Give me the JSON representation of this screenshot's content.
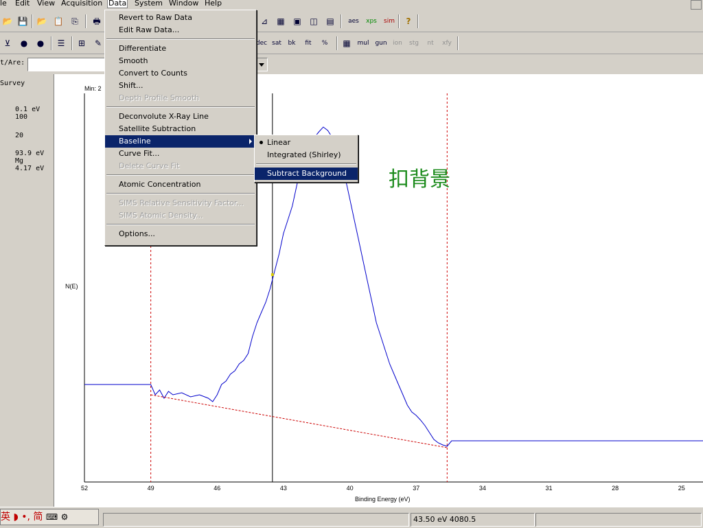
{
  "menubar": {
    "items": [
      "le",
      "Edit",
      "View",
      "Acquisition",
      "Data",
      "System",
      "Window",
      "Help"
    ]
  },
  "toolbar1": {
    "icons": [
      "open-icon",
      "save-icon",
      "open-folder-icon",
      "clipboard-icon",
      "copy-icon",
      "print-icon"
    ],
    "right_icons": [
      "line-plot-icon",
      "grid-plot-icon",
      "image-plot-icon",
      "peak-icon",
      "stack-icon"
    ],
    "aes_label": "aes",
    "xps_label": "xps",
    "sim_label": "sim",
    "help_label": "?"
  },
  "toolbar2": {
    "labels": [
      "dec",
      "sat",
      "bk",
      "fit",
      "%",
      "mul",
      "gun",
      "ion",
      "stg",
      "nt",
      "xfy"
    ]
  },
  "row3": {
    "label": "t/Are:",
    "input_value": ""
  },
  "left_panel": {
    "title": "Survey",
    "lines": [
      "0.1 eV",
      "100",
      "",
      "20",
      "",
      "93.9 eV",
      "Mg",
      "4.17 eV"
    ]
  },
  "plot": {
    "min_label": "Min: 2",
    "ylabel": "N(E)",
    "xlabel": "Binding Energy (eV)",
    "xticks": [
      "52",
      "49",
      "46",
      "43",
      "40",
      "37",
      "34",
      "31",
      "28",
      "25"
    ]
  },
  "annotation": "扣背景",
  "data_menu": {
    "items": [
      {
        "label": "Revert to Raw Data",
        "enabled": true
      },
      {
        "label": "Edit Raw Data...",
        "enabled": true
      },
      {
        "sep": true
      },
      {
        "label": "Differentiate",
        "enabled": true
      },
      {
        "label": "Smooth",
        "enabled": true
      },
      {
        "label": "Convert to Counts",
        "enabled": true
      },
      {
        "label": "Shift...",
        "enabled": true
      },
      {
        "label": "Depth Profile Smooth",
        "enabled": false
      },
      {
        "sep": true
      },
      {
        "label": "Deconvolute X-Ray Line",
        "enabled": true
      },
      {
        "label": "Satellite Subtraction",
        "enabled": true
      },
      {
        "label": "Baseline",
        "enabled": true,
        "selected": true,
        "submenu": true
      },
      {
        "label": "Curve Fit...",
        "enabled": true
      },
      {
        "label": "Delete Curve Fit",
        "enabled": false
      },
      {
        "sep": true
      },
      {
        "label": "Atomic Concentration",
        "enabled": true
      },
      {
        "sep": true
      },
      {
        "label": "SIMS Relative Sensitivity Factor...",
        "enabled": false
      },
      {
        "label": "SIMS Atomic Density...",
        "enabled": false
      },
      {
        "sep": true
      },
      {
        "label": "Options...",
        "enabled": true
      }
    ]
  },
  "baseline_submenu": {
    "items": [
      {
        "label": "Linear",
        "checked": true
      },
      {
        "label": "Integrated (Shirley)",
        "checked": false
      },
      {
        "sep": true
      },
      {
        "label": "Subtract Background",
        "selected": true
      }
    ]
  },
  "taskbar": {
    "ime_text": "英 ◗ •, 简",
    "status_value": "43.50 eV  4080.5"
  },
  "chart_data": {
    "type": "line",
    "xlabel": "Binding Energy (eV)",
    "ylabel": "N(E)",
    "x_reversed": true,
    "xlim": [
      52,
      24
    ],
    "cursor_x": 43.5,
    "region_markers": [
      49,
      35.6
    ],
    "series": [
      {
        "color": "#0000cc",
        "points": [
          [
            52,
            560
          ],
          [
            49,
            560
          ],
          [
            48.8,
            575
          ],
          [
            48.6,
            568
          ],
          [
            48.4,
            580
          ],
          [
            48.2,
            570
          ],
          [
            48,
            575
          ],
          [
            47.6,
            572
          ],
          [
            47.2,
            578
          ],
          [
            46.8,
            575
          ],
          [
            46.4,
            580
          ],
          [
            46.2,
            585
          ],
          [
            46,
            575
          ],
          [
            45.8,
            560
          ],
          [
            45.6,
            555
          ],
          [
            45.4,
            545
          ],
          [
            45.2,
            540
          ],
          [
            45,
            530
          ],
          [
            44.8,
            525
          ],
          [
            44.6,
            515
          ],
          [
            44.4,
            490
          ],
          [
            44.2,
            470
          ],
          [
            44,
            455
          ],
          [
            43.8,
            440
          ],
          [
            43.6,
            420
          ],
          [
            43.4,
            395
          ],
          [
            43.2,
            370
          ],
          [
            43,
            340
          ],
          [
            42.8,
            320
          ],
          [
            42.6,
            300
          ],
          [
            42.4,
            270
          ],
          [
            42.2,
            240
          ],
          [
            42,
            220
          ],
          [
            41.8,
            210
          ],
          [
            41.6,
            200
          ],
          [
            41.4,
            192
          ],
          [
            41.2,
            185
          ],
          [
            41,
            190
          ],
          [
            40.8,
            200
          ],
          [
            40.6,
            215
          ],
          [
            40.4,
            235
          ],
          [
            40.2,
            260
          ],
          [
            40,
            290
          ],
          [
            39.8,
            320
          ],
          [
            39.6,
            350
          ],
          [
            39.4,
            380
          ],
          [
            39.2,
            410
          ],
          [
            39,
            440
          ],
          [
            38.8,
            470
          ],
          [
            38.6,
            490
          ],
          [
            38.4,
            510
          ],
          [
            38.2,
            530
          ],
          [
            38,
            545
          ],
          [
            37.8,
            560
          ],
          [
            37.6,
            575
          ],
          [
            37.4,
            590
          ],
          [
            37.2,
            600
          ],
          [
            37,
            605
          ],
          [
            36.8,
            612
          ],
          [
            36.6,
            620
          ],
          [
            36.4,
            630
          ],
          [
            36.2,
            640
          ],
          [
            36,
            645
          ],
          [
            35.8,
            648
          ],
          [
            35.6,
            650
          ],
          [
            35.4,
            642
          ],
          [
            24,
            642
          ]
        ]
      },
      {
        "color": "#cc0000",
        "dashed": true,
        "points": [
          [
            49,
            575
          ],
          [
            35.6,
            652
          ]
        ]
      }
    ]
  }
}
